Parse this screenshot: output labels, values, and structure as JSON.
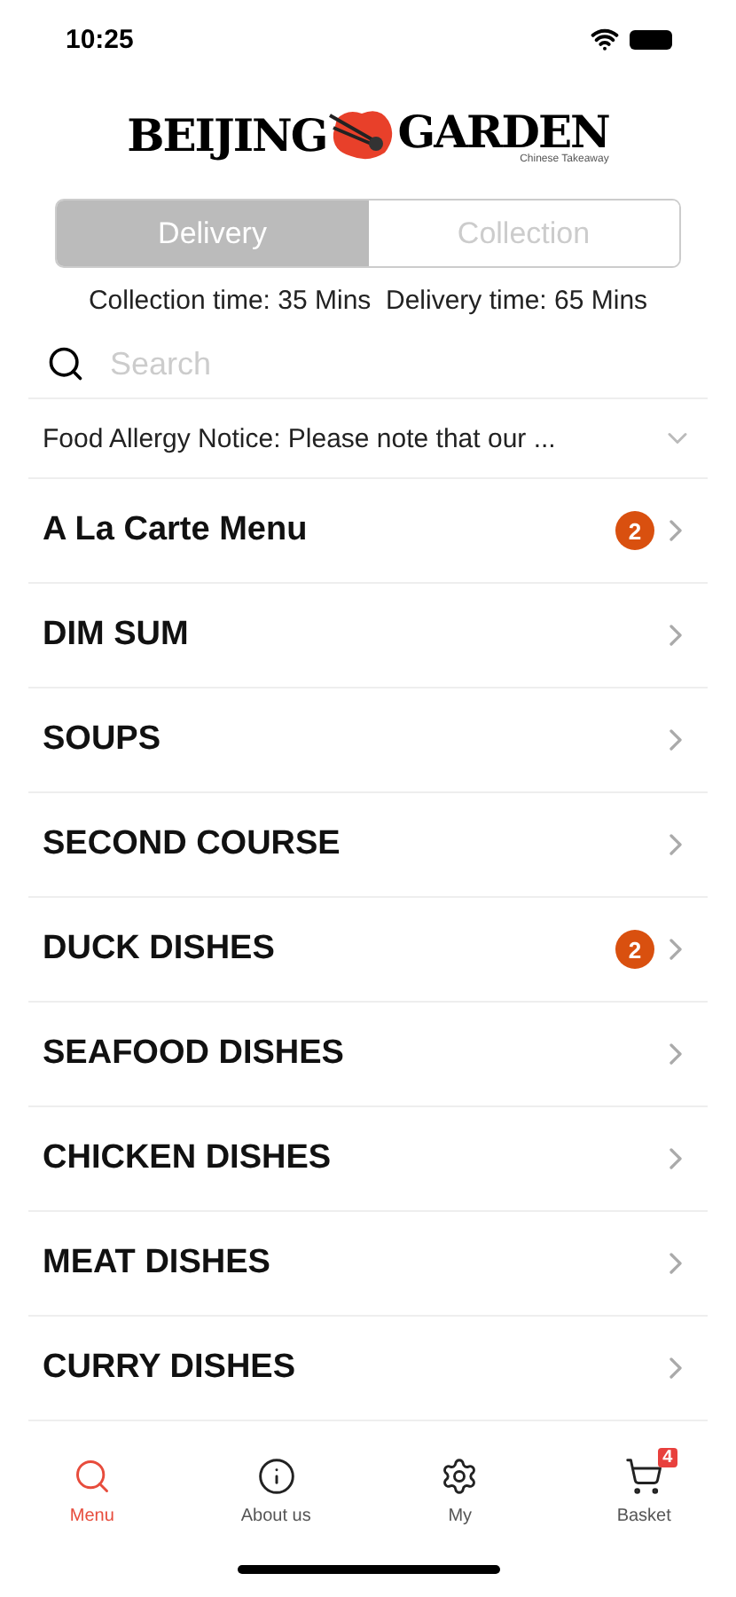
{
  "status_bar": {
    "time": "10:25"
  },
  "logo": {
    "left": "BEIJING",
    "right": "GARDEN",
    "tagline": "Chinese Takeaway"
  },
  "order_modes": [
    {
      "label": "Delivery",
      "selected": true
    },
    {
      "label": "Collection",
      "selected": false
    }
  ],
  "times": "Collection time: 35 Mins  Delivery time: 65 Mins",
  "search": {
    "placeholder": "Search"
  },
  "notice": {
    "text": "Food Allergy Notice: Please note that our ...",
    "expanded": false
  },
  "categories": [
    {
      "name": "A La Carte Menu",
      "badge": "2"
    },
    {
      "name": "DIM SUM"
    },
    {
      "name": "SOUPS"
    },
    {
      "name": "SECOND COURSE"
    },
    {
      "name": "DUCK DISHES",
      "badge": "2"
    },
    {
      "name": "SEAFOOD DISHES"
    },
    {
      "name": "CHICKEN DISHES"
    },
    {
      "name": "MEAT DISHES"
    },
    {
      "name": "CURRY DISHES"
    }
  ],
  "tab_bar": [
    {
      "kind": "search",
      "label": "Menu",
      "selected": true
    },
    {
      "kind": "info",
      "label": "About us",
      "selected": false
    },
    {
      "kind": "gear",
      "label": "My",
      "selected": false
    },
    {
      "kind": "cart",
      "label": "Basket",
      "selected": false,
      "badge": "4"
    }
  ]
}
